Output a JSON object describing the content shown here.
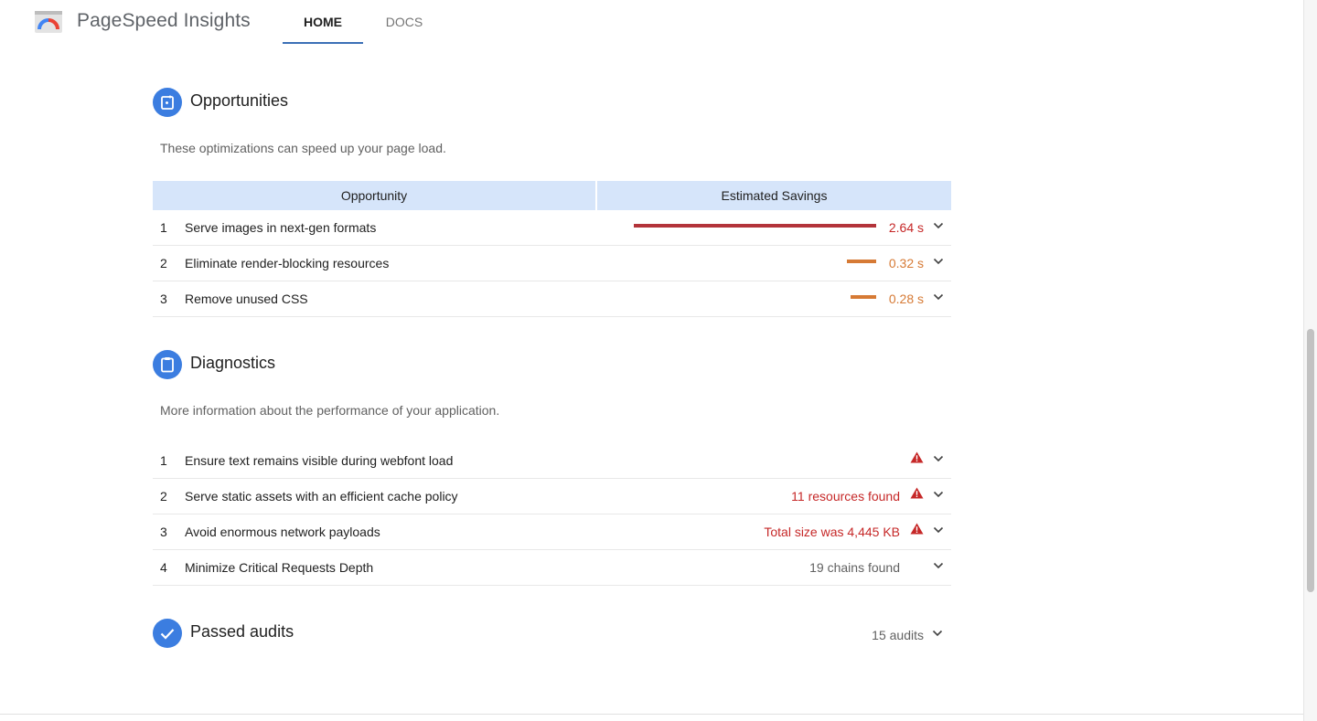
{
  "header": {
    "brand": "PageSpeed Insights",
    "tabs": [
      {
        "label": "HOME",
        "active": true
      },
      {
        "label": "DOCS",
        "active": false
      }
    ]
  },
  "opportunities": {
    "title": "Opportunities",
    "description": "These optimizations can speed up your page load.",
    "columns": [
      "Opportunity",
      "Estimated Savings"
    ],
    "rows": [
      {
        "num": "1",
        "title": "Serve images in next-gen formats",
        "savings": "2.64 s",
        "savings_seconds": 2.64,
        "color": "#b3333a"
      },
      {
        "num": "2",
        "title": "Eliminate render-blocking resources",
        "savings": "0.32 s",
        "savings_seconds": 0.32,
        "color": "#d67a35"
      },
      {
        "num": "3",
        "title": "Remove unused CSS",
        "savings": "0.28 s",
        "savings_seconds": 0.28,
        "color": "#d67a35"
      }
    ]
  },
  "diagnostics": {
    "title": "Diagnostics",
    "description": "More information about the performance of your application.",
    "rows": [
      {
        "num": "1",
        "title": "Ensure text remains visible during webfont load",
        "info": "",
        "warning": true
      },
      {
        "num": "2",
        "title": "Serve static assets with an efficient cache policy",
        "info": "11 resources found",
        "warning": true
      },
      {
        "num": "3",
        "title": "Avoid enormous network payloads",
        "info": "Total size was 4,445 KB",
        "warning": true
      },
      {
        "num": "4",
        "title": "Minimize Critical Requests Depth",
        "info": "19 chains found",
        "warning": false
      }
    ]
  },
  "passed": {
    "title": "Passed audits",
    "count": "15 audits"
  },
  "colors": {
    "accent": "#3b7de0",
    "tab_underline": "#3b6fb6",
    "fail": "#c62828",
    "average": "#d67a35",
    "table_header": "#d6e5fa"
  }
}
